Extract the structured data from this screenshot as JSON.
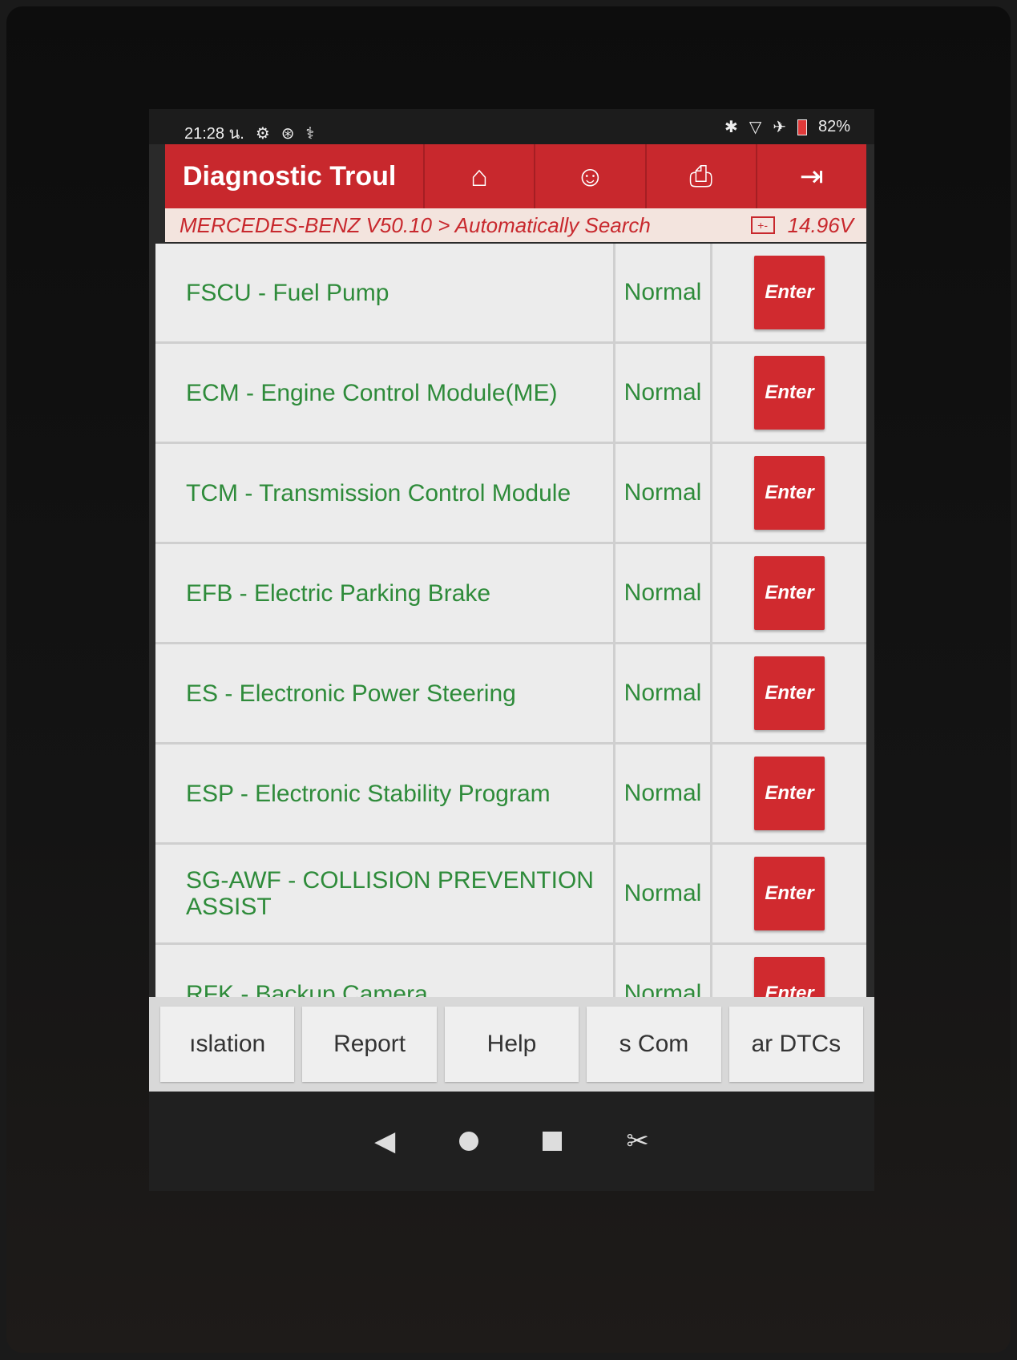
{
  "status_bar": {
    "time": "21:28 น.",
    "battery": "82%"
  },
  "header": {
    "title": "Diagnostic Troul",
    "buttons": [
      {
        "name": "home-icon",
        "glyph": "🏠"
      },
      {
        "name": "user-icon",
        "glyph": "👤"
      },
      {
        "name": "print-icon",
        "glyph": "🖶"
      },
      {
        "name": "exit-icon",
        "glyph": "⇥"
      }
    ]
  },
  "breadcrumb": {
    "path": "MERCEDES-BENZ V50.10 > Automatically Search",
    "battery_icon": "+-",
    "voltage": "14.96V"
  },
  "modules": [
    {
      "name": "FSCU - Fuel Pump",
      "status": "Normal",
      "action": "Enter"
    },
    {
      "name": "ECM - Engine Control Module(ME)",
      "status": "Normal",
      "action": "Enter"
    },
    {
      "name": "TCM - Transmission Control Module",
      "status": "Normal",
      "action": "Enter"
    },
    {
      "name": "EFB - Electric Parking Brake",
      "status": "Normal",
      "action": "Enter"
    },
    {
      "name": "ES - Electronic Power Steering",
      "status": "Normal",
      "action": "Enter"
    },
    {
      "name": "ESP - Electronic Stability Program",
      "status": "Normal",
      "action": "Enter"
    },
    {
      "name": "SG-AWF - COLLISION PREVENTION ASSIST",
      "status": "Normal",
      "action": "Enter"
    },
    {
      "name": "RFK - Backup Camera",
      "status": "Normal",
      "action": "Enter"
    }
  ],
  "toolbar": {
    "buttons": [
      "ıslation",
      "Report",
      "Help",
      "s    Com",
      "ar DTCs"
    ]
  },
  "colors": {
    "brand_red": "#c8282d",
    "status_green": "#2e8b3a"
  }
}
